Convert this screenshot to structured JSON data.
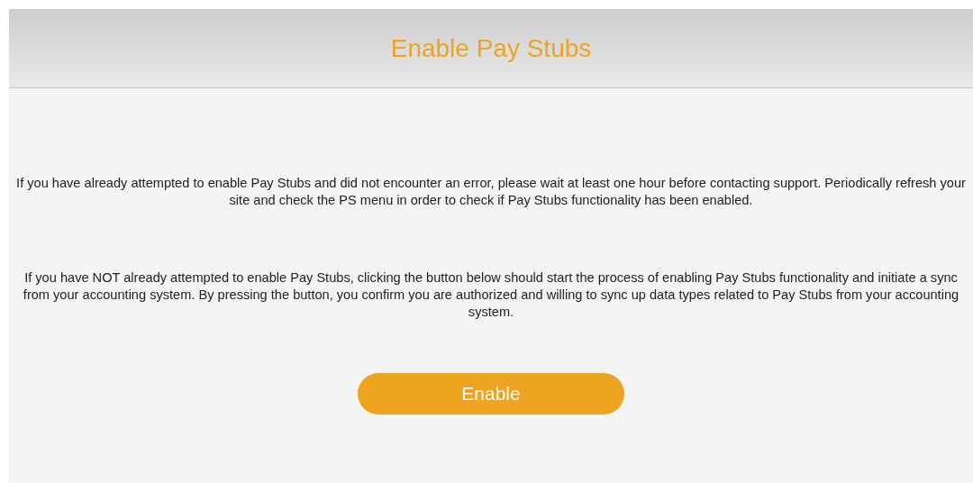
{
  "header": {
    "title": "Enable Pay Stubs"
  },
  "paragraphs": [
    "If you have already attempted to enable Pay Stubs and did not encounter an error, please wait at least one hour before contacting support. Periodically refresh your site and check the PS menu in order to check if Pay Stubs functionality has been enabled.",
    "If you have NOT already attempted to enable Pay Stubs, clicking the button below should start the process of enabling Pay Stubs functionality and initiate a sync from your accounting system. By pressing the button, you confirm you are authorized and willing to sync up data types related to Pay Stubs from your accounting system."
  ],
  "button": {
    "label": "Enable"
  }
}
